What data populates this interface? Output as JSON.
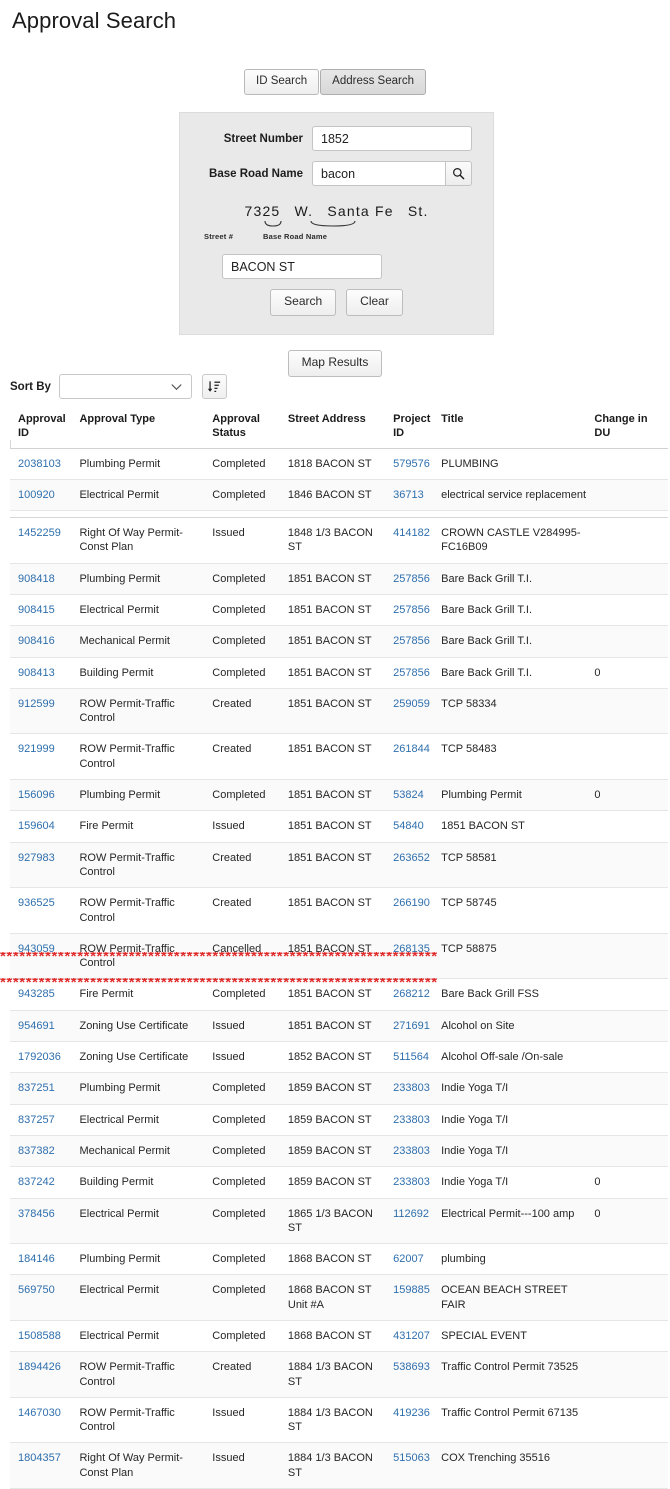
{
  "page": {
    "title": "Approval Search"
  },
  "tabs": [
    {
      "label": "ID Search",
      "active": false
    },
    {
      "label": "Address Search",
      "active": true
    }
  ],
  "search_form": {
    "street_number": {
      "label": "Street Number",
      "value": "1852",
      "placeholder": ""
    },
    "base_road_name": {
      "label": "Base Road Name",
      "value": "bacon",
      "placeholder": ""
    },
    "magnifier_icon": "search-icon",
    "example": {
      "number": "7325",
      "direction": "W.",
      "road": "Santa Fe",
      "suffix": "St.",
      "brace_left_label": "Street #",
      "brace_right_label": "Base Road Name"
    },
    "road_result": {
      "value": "BACON ST",
      "placeholder": ""
    },
    "search_button": "Search",
    "clear_button": "Clear"
  },
  "map_results_button": "Map Results",
  "sort": {
    "label": "Sort By",
    "selected": "",
    "placeholder": "",
    "chevron_icon": "chevron-down-icon",
    "direction_icon": "sort-amount-down-icon"
  },
  "table": {
    "headers": [
      "Approval ID",
      "Approval Type",
      "Approval Status",
      "Street Address",
      "Project ID",
      "Title",
      "Change in DU"
    ],
    "rows": [
      {
        "approval_id": "2038103",
        "approval_type": "Plumbing Permit",
        "approval_status": "Completed",
        "street_address": "1818 BACON ST",
        "project_id": "579576",
        "title": "PLUMBING",
        "change_in_du": ""
      },
      {
        "approval_id": "100920",
        "approval_type": "Electrical Permit",
        "approval_status": "Completed",
        "street_address": "1846 BACON ST",
        "project_id": "36713",
        "title": "electrical service replacement",
        "change_in_du": ""
      },
      {
        "approval_id": "1452259",
        "approval_type": "Right Of Way Permit-Const Plan",
        "approval_status": "Issued",
        "street_address": "1848 1/3 BACON ST",
        "project_id": "414182",
        "title": "CROWN CASTLE V284995-FC16B09",
        "change_in_du": "",
        "group_start": true
      },
      {
        "approval_id": "908418",
        "approval_type": "Plumbing Permit",
        "approval_status": "Completed",
        "street_address": "1851 BACON ST",
        "project_id": "257856",
        "title": "Bare Back Grill T.I.",
        "change_in_du": ""
      },
      {
        "approval_id": "908415",
        "approval_type": "Electrical Permit",
        "approval_status": "Completed",
        "street_address": "1851 BACON ST",
        "project_id": "257856",
        "title": "Bare Back Grill T.I.",
        "change_in_du": ""
      },
      {
        "approval_id": "908416",
        "approval_type": "Mechanical Permit",
        "approval_status": "Completed",
        "street_address": "1851 BACON ST",
        "project_id": "257856",
        "title": "Bare Back Grill T.I.",
        "change_in_du": ""
      },
      {
        "approval_id": "908413",
        "approval_type": "Building Permit",
        "approval_status": "Completed",
        "street_address": "1851 BACON ST",
        "project_id": "257856",
        "title": "Bare Back Grill T.I.",
        "change_in_du": "0"
      },
      {
        "approval_id": "912599",
        "approval_type": "ROW Permit-Traffic Control",
        "approval_status": "Created",
        "street_address": "1851 BACON ST",
        "project_id": "259059",
        "title": "TCP 58334",
        "change_in_du": ""
      },
      {
        "approval_id": "921999",
        "approval_type": "ROW Permit-Traffic Control",
        "approval_status": "Created",
        "street_address": "1851 BACON ST",
        "project_id": "261844",
        "title": "TCP 58483",
        "change_in_du": ""
      },
      {
        "approval_id": "156096",
        "approval_type": "Plumbing Permit",
        "approval_status": "Completed",
        "street_address": "1851 BACON ST",
        "project_id": "53824",
        "title": "Plumbing Permit",
        "change_in_du": "0"
      },
      {
        "approval_id": "159604",
        "approval_type": "Fire Permit",
        "approval_status": "Issued",
        "street_address": "1851 BACON ST",
        "project_id": "54840",
        "title": "1851 BACON ST",
        "change_in_du": ""
      },
      {
        "approval_id": "927983",
        "approval_type": "ROW Permit-Traffic Control",
        "approval_status": "Created",
        "street_address": "1851 BACON ST",
        "project_id": "263652",
        "title": "TCP 58581",
        "change_in_du": ""
      },
      {
        "approval_id": "936525",
        "approval_type": "ROW Permit-Traffic Control",
        "approval_status": "Created",
        "street_address": "1851 BACON ST",
        "project_id": "266190",
        "title": "TCP 58745",
        "change_in_du": ""
      },
      {
        "approval_id": "943059",
        "approval_type": "ROW Permit-Traffic Control",
        "approval_status": "Cancelled",
        "street_address": "1851 BACON ST",
        "project_id": "268135",
        "title": "TCP 58875",
        "change_in_du": ""
      },
      {
        "approval_id": "943285",
        "approval_type": "Fire Permit",
        "approval_status": "Completed",
        "street_address": "1851 BACON ST",
        "project_id": "268212",
        "title": "Bare Back Grill FSS",
        "change_in_du": ""
      },
      {
        "approval_id": "954691",
        "approval_type": "Zoning Use Certificate",
        "approval_status": "Issued",
        "street_address": "1851 BACON ST",
        "project_id": "271691",
        "title": "Alcohol on Site",
        "change_in_du": ""
      },
      {
        "approval_id": "1792036",
        "approval_type": "Zoning Use Certificate",
        "approval_status": "Issued",
        "street_address": "1852 BACON ST",
        "project_id": "511564",
        "title": "Alcohol Off-sale /On-sale",
        "change_in_du": "",
        "highlighted": true
      },
      {
        "approval_id": "837251",
        "approval_type": "Plumbing Permit",
        "approval_status": "Completed",
        "street_address": "1859 BACON ST",
        "project_id": "233803",
        "title": "Indie Yoga T/I",
        "change_in_du": ""
      },
      {
        "approval_id": "837257",
        "approval_type": "Electrical Permit",
        "approval_status": "Completed",
        "street_address": "1859 BACON ST",
        "project_id": "233803",
        "title": "Indie Yoga T/I",
        "change_in_du": ""
      },
      {
        "approval_id": "837382",
        "approval_type": "Mechanical Permit",
        "approval_status": "Completed",
        "street_address": "1859 BACON ST",
        "project_id": "233803",
        "title": "Indie Yoga T/I",
        "change_in_du": ""
      },
      {
        "approval_id": "837242",
        "approval_type": "Building Permit",
        "approval_status": "Completed",
        "street_address": "1859 BACON ST",
        "project_id": "233803",
        "title": "Indie Yoga T/I",
        "change_in_du": "0"
      },
      {
        "approval_id": "378456",
        "approval_type": "Electrical Permit",
        "approval_status": "Completed",
        "street_address": "1865 1/3 BACON ST",
        "project_id": "112692",
        "title": "Electrical Permit---100 amp",
        "change_in_du": "0"
      },
      {
        "approval_id": "184146",
        "approval_type": "Plumbing Permit",
        "approval_status": "Completed",
        "street_address": "1868 BACON ST",
        "project_id": "62007",
        "title": "plumbing",
        "change_in_du": ""
      },
      {
        "approval_id": "569750",
        "approval_type": "Electrical Permit",
        "approval_status": "Completed",
        "street_address": "1868 BACON ST Unit #A",
        "project_id": "159885",
        "title": "OCEAN BEACH STREET FAIR",
        "change_in_du": ""
      },
      {
        "approval_id": "1508588",
        "approval_type": "Electrical Permit",
        "approval_status": "Completed",
        "street_address": "1868 BACON ST",
        "project_id": "431207",
        "title": "SPECIAL EVENT",
        "change_in_du": ""
      },
      {
        "approval_id": "1894426",
        "approval_type": "ROW Permit-Traffic Control",
        "approval_status": "Created",
        "street_address": "1884 1/3 BACON ST",
        "project_id": "538693",
        "title": "Traffic Control Permit 73525",
        "change_in_du": ""
      },
      {
        "approval_id": "1467030",
        "approval_type": "ROW Permit-Traffic Control",
        "approval_status": "Issued",
        "street_address": "1884 1/3 BACON ST",
        "project_id": "419236",
        "title": "Traffic Control Permit 67135",
        "change_in_du": ""
      },
      {
        "approval_id": "1804357",
        "approval_type": "Right Of Way Permit-Const Plan",
        "approval_status": "Issued",
        "street_address": "1884 1/3 BACON ST",
        "project_id": "515063",
        "title": "COX Trenching 35516",
        "change_in_du": ""
      }
    ]
  },
  "annotation": {
    "marker_char": "*",
    "marker_color": "#e02b2b",
    "marker_count": 68
  },
  "colors": {
    "link": "#2f6fad",
    "panel_bg": "#e9e9e9",
    "page_bg": "#ffffff"
  }
}
